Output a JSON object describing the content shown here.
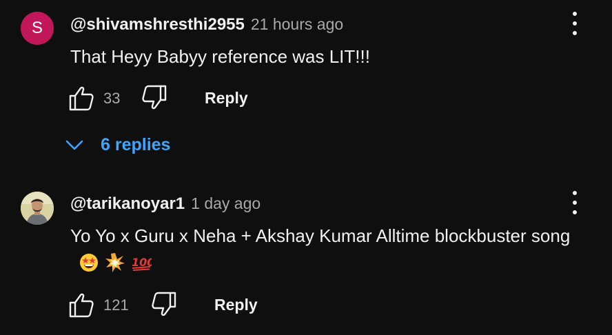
{
  "theme": {
    "background": "#0f0f0f",
    "text_primary": "#f1f1f1",
    "text_secondary": "#aaaaaa",
    "link_blue": "#3ea6ff",
    "avatar_red": "#c2185b"
  },
  "comments": [
    {
      "avatar_letter": "S",
      "handle": "@shivamshresthi2955",
      "time": "21 hours ago",
      "text": "That Heyy Babyy reference was LIT!!!",
      "like_count": "33",
      "reply_label": "Reply",
      "replies_label": "6 replies"
    },
    {
      "avatar_icon": "user-photo-avatar",
      "handle": "@tarikanoyar1",
      "time": "1 day ago",
      "text": "Yo Yo x Guru x Neha + Akshay Kumar Alltime blockbuster song",
      "emojis": [
        "star-struck-emoji",
        "collision-emoji",
        "hundred-points-emoji"
      ],
      "like_count": "121",
      "reply_label": "Reply"
    }
  ]
}
